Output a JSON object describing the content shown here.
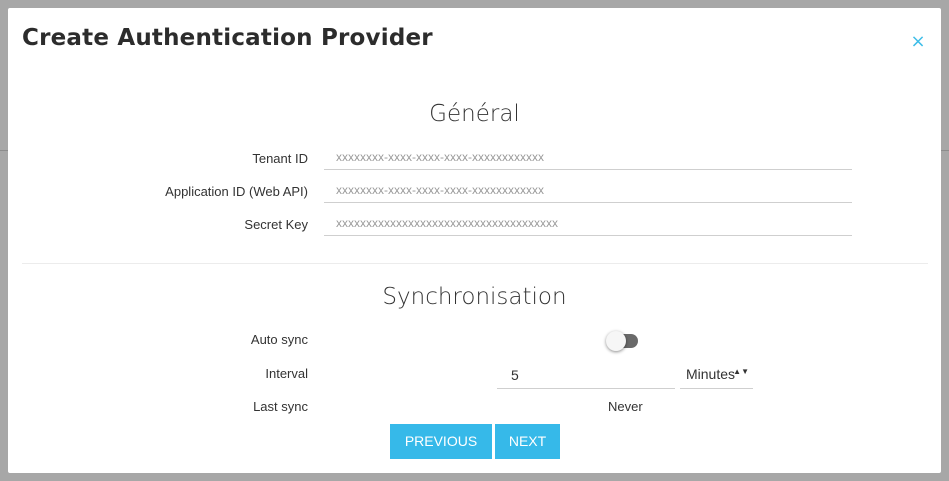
{
  "modal": {
    "title": "Create Authentication Provider",
    "close_label": "×"
  },
  "general": {
    "heading": "Général",
    "fields": [
      {
        "label": "Tenant ID",
        "placeholder": "xxxxxxxx-xxxx-xxxx-xxxx-xxxxxxxxxxxx",
        "value": ""
      },
      {
        "label": "Application ID (Web API)",
        "placeholder": "xxxxxxxx-xxxx-xxxx-xxxx-xxxxxxxxxxxx",
        "value": ""
      },
      {
        "label": "Secret Key",
        "placeholder": "xxxxxxxxxxxxxxxxxxxxxxxxxxxxxxxxxxxxx",
        "value": ""
      }
    ]
  },
  "sync": {
    "heading": "Synchronisation",
    "auto_sync_label": "Auto sync",
    "auto_sync_enabled": false,
    "interval_label": "Interval",
    "interval_value": "5",
    "interval_unit": "Minutes",
    "interval_unit_arrows": "▲▼",
    "last_sync_label": "Last sync",
    "last_sync_value": "Never"
  },
  "footer": {
    "previous_label": "PREVIOUS",
    "next_label": "NEXT"
  },
  "colors": {
    "accent": "#36b9e9",
    "close_icon": "#3dbde8"
  }
}
